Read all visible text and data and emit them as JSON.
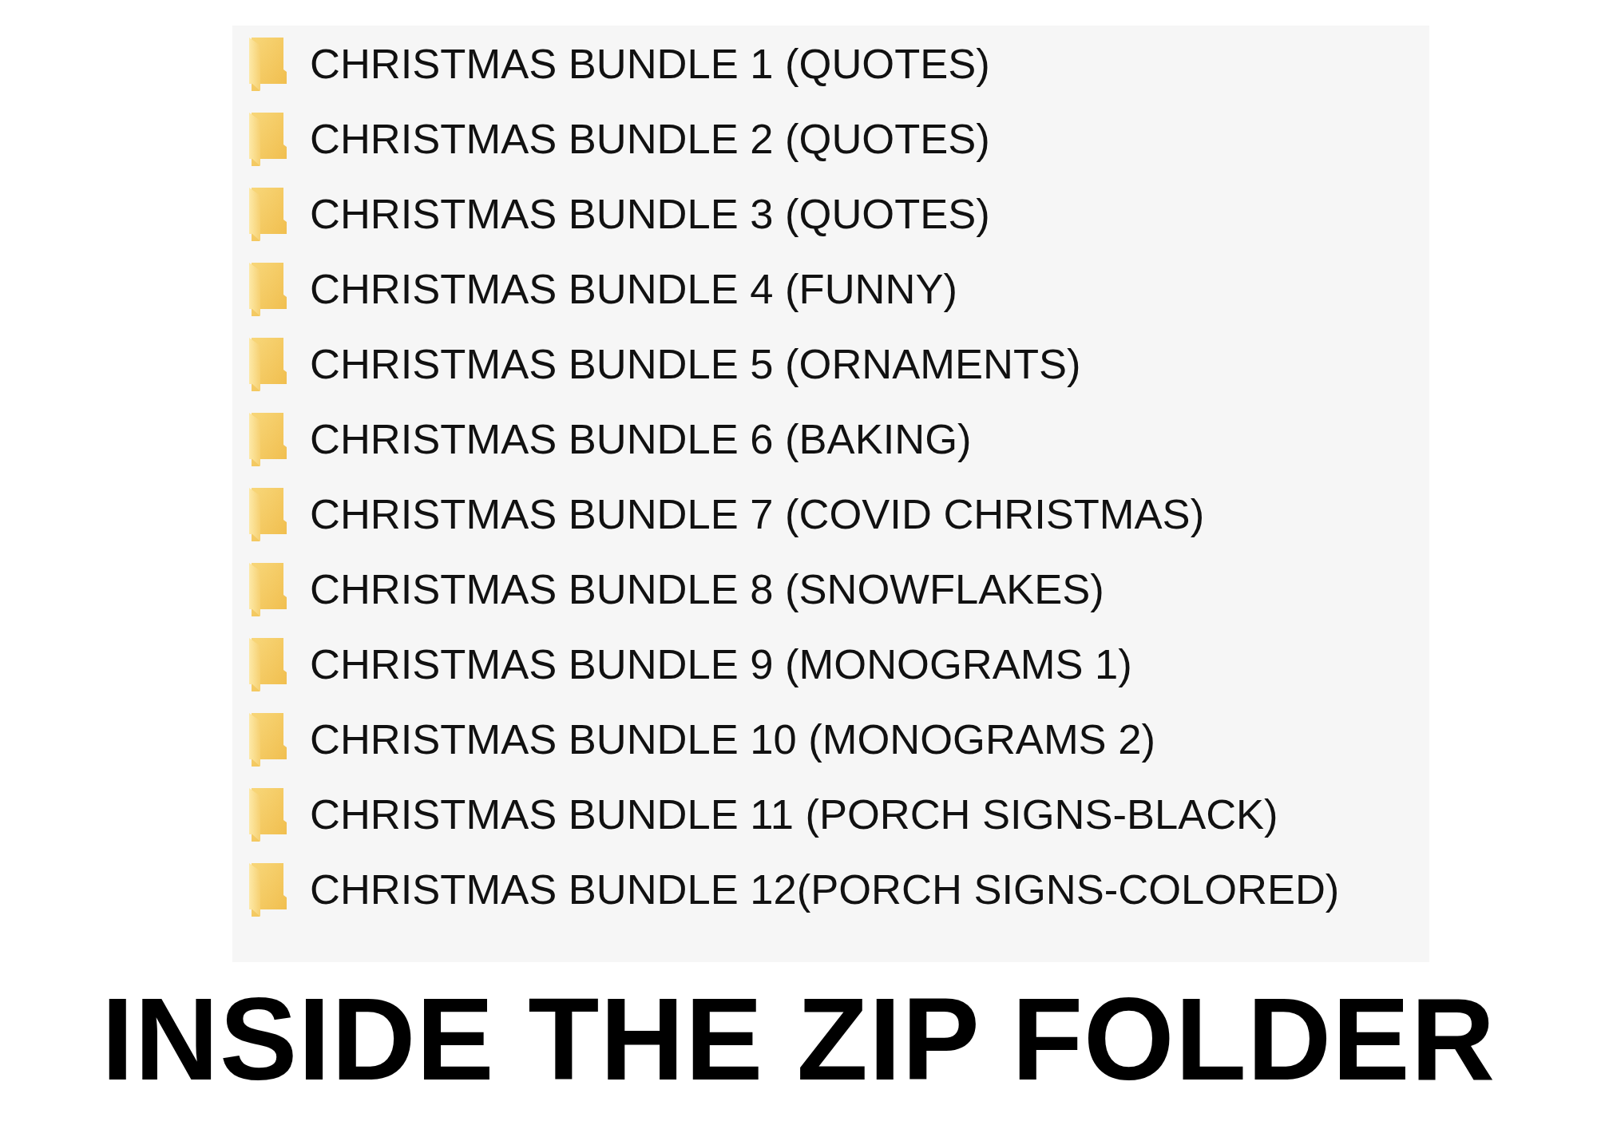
{
  "folder_list": {
    "items": [
      {
        "name": "CHRISTMAS BUNDLE 1 (QUOTES)"
      },
      {
        "name": "CHRISTMAS BUNDLE 2 (QUOTES)"
      },
      {
        "name": "CHRISTMAS BUNDLE 3 (QUOTES)"
      },
      {
        "name": "CHRISTMAS BUNDLE 4 (FUNNY)"
      },
      {
        "name": "CHRISTMAS BUNDLE 5 (ORNAMENTS)"
      },
      {
        "name": "CHRISTMAS BUNDLE 6 (BAKING)"
      },
      {
        "name": "CHRISTMAS BUNDLE 7 (COVID CHRISTMAS)"
      },
      {
        "name": "CHRISTMAS BUNDLE 8 (SNOWFLAKES)"
      },
      {
        "name": "CHRISTMAS BUNDLE 9 (MONOGRAMS 1)"
      },
      {
        "name": "CHRISTMAS BUNDLE 10 (MONOGRAMS 2)"
      },
      {
        "name": "CHRISTMAS BUNDLE 11 (PORCH SIGNS-BLACK)"
      },
      {
        "name": "CHRISTMAS BUNDLE 12(PORCH SIGNS-COLORED)"
      }
    ]
  },
  "caption": "INSIDE THE ZIP FOLDER"
}
